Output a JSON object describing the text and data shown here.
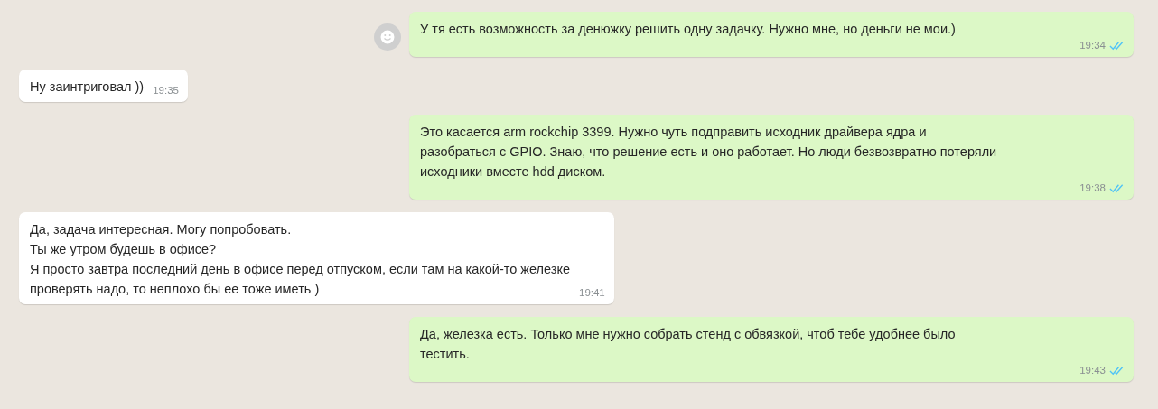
{
  "messages": [
    {
      "outgoing": true,
      "avatar": true,
      "text": "У тя есть возможность за денюжку решить одну задачку. Нужно мне, но деньги не мои.)",
      "time": "19:34",
      "read": true
    },
    {
      "outgoing": false,
      "text": "Ну заинтриговал ))",
      "time": "19:35"
    },
    {
      "outgoing": true,
      "text": "Это касается arm rockchip 3399. Нужно чуть подправить исходник драйвера ядра и\nразобраться с GPIO. Знаю, что решение есть и оно работает. Но люди безвозвратно потеряли\nисходники вместе hdd диском.",
      "time": "19:38",
      "read": true
    },
    {
      "outgoing": false,
      "text": "Да, задача интересная. Могу попробовать.\nТы же утром будешь в офисе?\nЯ просто завтра последний день в офисе перед отпуском, если там на какой-то железке\nпроверять надо, то неплохо бы ее тоже иметь )",
      "time": "19:41"
    },
    {
      "outgoing": true,
      "text": "Да, железка есть. Только мне нужно собрать стенд с обвязкой, чтоб тебе удобнее было\nтестить.",
      "time": "19:43",
      "read": true
    }
  ]
}
